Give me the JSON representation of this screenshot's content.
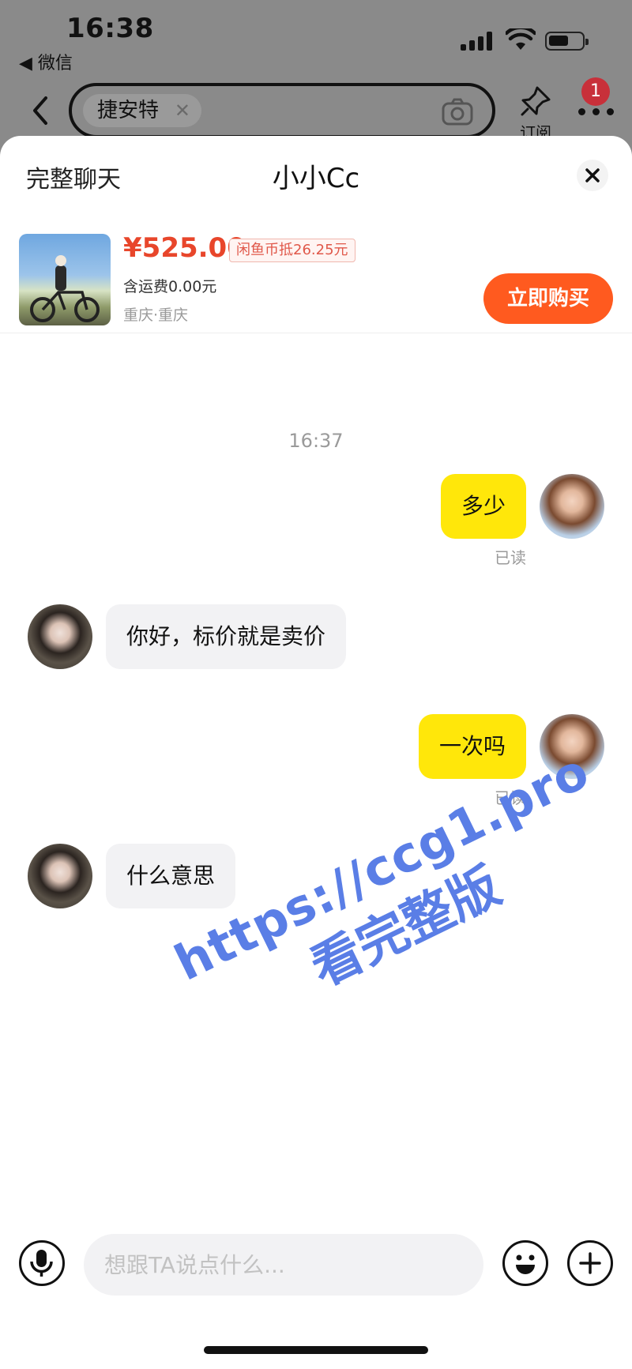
{
  "status": {
    "time": "16:38",
    "back_app": "◀ 微信"
  },
  "nav": {
    "search_chip": "捷安特",
    "subscribe_label": "订阅",
    "notification_count": "1"
  },
  "sheet": {
    "full_chat_label": "完整聊天",
    "title": "小小Cc"
  },
  "product": {
    "price": "¥525.00",
    "coin_tag": "闲鱼币抵26.25元",
    "shipping": "含运费0.00元",
    "location": "重庆·重庆",
    "buy_label": "立即购买"
  },
  "chat": {
    "time": "16:37",
    "messages": [
      {
        "sender": "me",
        "text": "多少",
        "status": "已读"
      },
      {
        "sender": "other",
        "text": "你好，标价就是卖价"
      },
      {
        "sender": "me",
        "text": "一次吗",
        "status": "已读"
      },
      {
        "sender": "other",
        "text": "什么意思"
      }
    ]
  },
  "watermark": {
    "url": "https://ccg1.pro",
    "text": "看完整版"
  },
  "input": {
    "placeholder": "想跟TA说点什么..."
  },
  "colors": {
    "accent_yellow": "#ffe70a",
    "buy_orange": "#ff5a1f",
    "price_red": "#e8462b"
  }
}
